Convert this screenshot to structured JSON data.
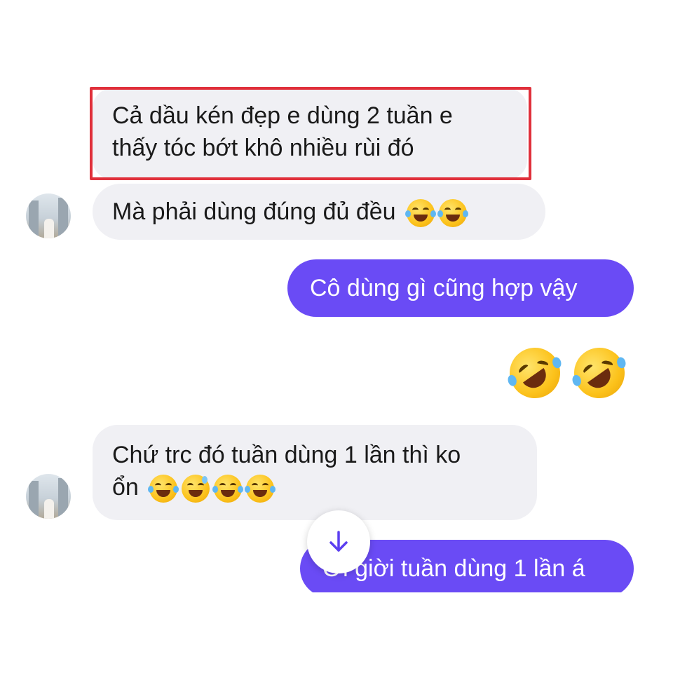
{
  "messages": [
    {
      "id": "m1",
      "side": "incoming",
      "lines": [
        "Cả dầu kén đẹp e dùng 2 tuần e",
        "thấy tóc bớt khô nhiều rùi đó"
      ],
      "highlighted": true
    },
    {
      "id": "m2",
      "side": "incoming",
      "text": "Mà phải dùng đúng đủ đều",
      "emojis": [
        "face-with-tears-of-joy",
        "face-with-tears-of-joy"
      ]
    },
    {
      "id": "m3",
      "side": "outgoing",
      "text": "Cô dùng gì cũng hợp vậy"
    },
    {
      "id": "m4",
      "side": "outgoing",
      "emojis": [
        "rolling-on-the-floor-laughing",
        "rolling-on-the-floor-laughing"
      ]
    },
    {
      "id": "m5",
      "side": "incoming",
      "lines": [
        "Chứ trc đó tuần dùng 1 lần thì ko",
        "ổn"
      ],
      "emojis": [
        "face-with-tears-of-joy",
        "grinning-face-with-sweat",
        "face-with-tears-of-joy",
        "face-with-tears-of-joy"
      ]
    },
    {
      "id": "m6",
      "side": "outgoing",
      "text": "Ơi giời tuần dùng 1 lần á"
    }
  ],
  "scroll_button": {
    "icon": "arrow-down-icon"
  },
  "colors": {
    "incoming_bubble": "#f0f0f4",
    "outgoing_bubble": "#6a4bf5",
    "highlight_border": "#e0303b"
  }
}
